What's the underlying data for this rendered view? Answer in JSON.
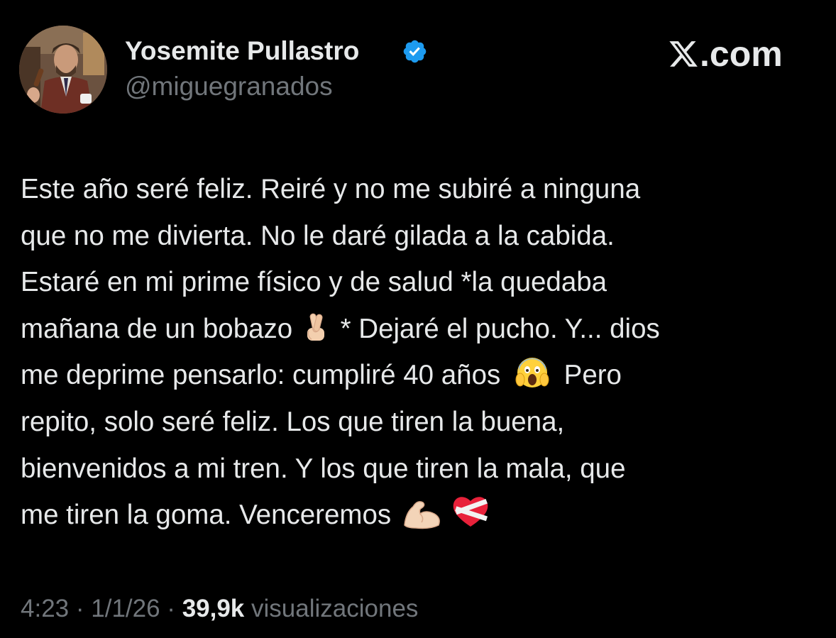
{
  "author": {
    "display_name": "Yosemite Pullastro",
    "handle": "@miguegranados",
    "verified": true,
    "avatar_icon": "profile-photo"
  },
  "brand": {
    "logo_icon": "x-logo-icon",
    "text": ".com"
  },
  "tweet": {
    "lines": {
      "l1": "Este año seré feliz. Reiré y no me subiré a ninguna",
      "l2": "que no me divierta. No le daré gilada a la cabida.",
      "l3": "Estaré en mi prime físico y de salud *la quedaba",
      "l4a": "mañana de un bobazo",
      "l4b": "* Dejaré el pucho. Y... dios",
      "l5a": "me deprime pensarlo: cumpliré 40 años",
      "l5b": "Pero",
      "l6": "repito, solo seré feliz. Los que tiren la buena,",
      "l7": "bienvenidos a mi tren. Y los que tiren la mala, que",
      "l8": "me tiren la goma. Venceremos"
    },
    "emojis": [
      "crossed-fingers-emoji",
      "screaming-face-emoji",
      "flexed-biceps-emoji",
      "mending-heart-emoji"
    ]
  },
  "meta": {
    "time": "4:23",
    "separator": "·",
    "date": "1/1/26",
    "views_count": "39,9k",
    "views_label": "visualizaciones"
  },
  "colors": {
    "background": "#000000",
    "primary_text": "#e7e9ea",
    "secondary_text": "#71767b",
    "verified_blue": "#1d9bf0"
  }
}
